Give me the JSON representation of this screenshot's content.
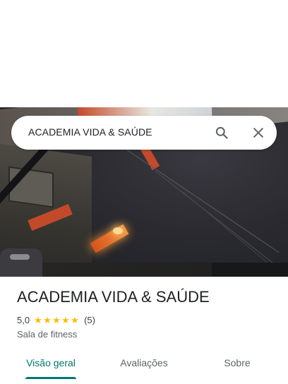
{
  "search": {
    "query": "ACADEMIA VIDA & SAÚDE",
    "search_icon": "search-icon",
    "close_icon": "close-icon"
  },
  "place": {
    "name": "ACADEMIA VIDA & SAÚDE",
    "rating": "5,0",
    "stars": 5,
    "star_glyph": "★",
    "review_count": "(5)",
    "category": "Sala de fitness"
  },
  "tabs": [
    {
      "label": "Visão geral",
      "active": true
    },
    {
      "label": "Avaliações",
      "active": false
    },
    {
      "label": "Sobre",
      "active": false
    }
  ],
  "colors": {
    "accent": "#01786f",
    "star": "#fbbc04",
    "text": "#202124",
    "secondary_text": "#5f6368"
  }
}
